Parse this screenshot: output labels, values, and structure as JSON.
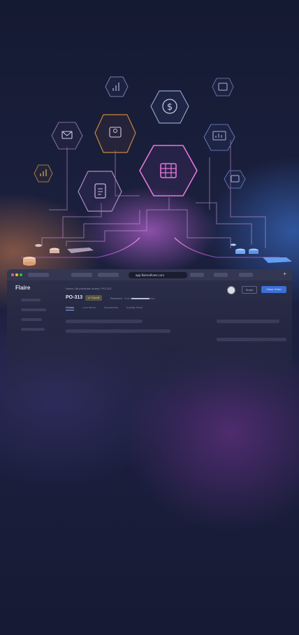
{
  "colors": {
    "accent": "#3b6fd6",
    "magenta": "#e06ad6",
    "orange": "#ff9a5a",
    "blue": "#4f8cff"
  },
  "icons": [
    "bar-chart-icon",
    "dollar-icon",
    "image-icon",
    "mail-icon",
    "user-card-icon",
    "presentation-chart-icon",
    "table-icon",
    "document-icon"
  ],
  "browser": {
    "url": "app.flaireuflows.com",
    "app_name": "Flaire",
    "breadcrumb": "Home  /  All purchase orders  /  PO-313",
    "po_id": "PO-313",
    "status": "In Transit",
    "meta": "Received · 3 of 4 lines",
    "progress": 0.75,
    "share_label": "Share",
    "primary_label": "Close Order",
    "tabs": [
      "Details",
      "Line Items",
      "Documents",
      "Activity Feed"
    ]
  }
}
